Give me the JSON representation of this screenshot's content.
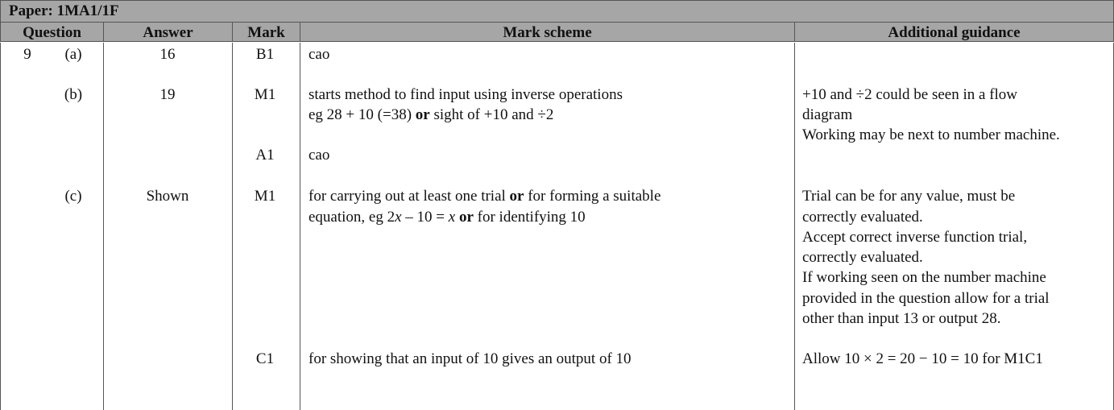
{
  "paper_title": "Paper: 1MA1/1F",
  "headers": {
    "question": "Question",
    "answer": "Answer",
    "mark": "Mark",
    "scheme": "Mark scheme",
    "guidance": "Additional guidance"
  },
  "question_number": "9",
  "parts": {
    "a": {
      "label": "(a)",
      "answer": "16",
      "mark": "B1",
      "scheme": "cao"
    },
    "b": {
      "label": "(b)",
      "answer": "19",
      "mark1": "M1",
      "scheme1_line1": "starts method to find input using inverse operations",
      "scheme1_line2a": "eg 28 + 10 (=38) ",
      "scheme1_line2b": "or",
      "scheme1_line2c": " sight of +10 and ÷2",
      "guidance": [
        "+10 and ÷2 could be seen in a flow",
        "diagram",
        "Working may be next to number machine."
      ],
      "mark2": "A1",
      "scheme2": "cao"
    },
    "c": {
      "label": "(c)",
      "answer": "Shown",
      "mark1": "M1",
      "scheme1_line1a": "for carrying out at least one trial ",
      "scheme1_line1b": "or",
      "scheme1_line1c": " for forming a suitable",
      "scheme1_line2a": "equation, eg 2",
      "scheme1_line2b": "x",
      "scheme1_line2c": " – 10 = ",
      "scheme1_line2d": "x",
      "scheme1_line2e": " ",
      "scheme1_line2f": "or",
      "scheme1_line2g": " for identifying 10",
      "guidance1": [
        "Trial can be for any value, must be",
        "correctly evaluated.",
        "Accept correct inverse function trial,",
        "correctly evaluated.",
        "If working seen on the number machine",
        "provided in the question allow for a trial",
        "other than input 13 or output 28."
      ],
      "mark2": "C1",
      "scheme2": "for showing that an input of 10 gives an output of 10",
      "guidance2": "Allow 10 × 2 = 20 − 10 = 10 for M1C1"
    }
  }
}
